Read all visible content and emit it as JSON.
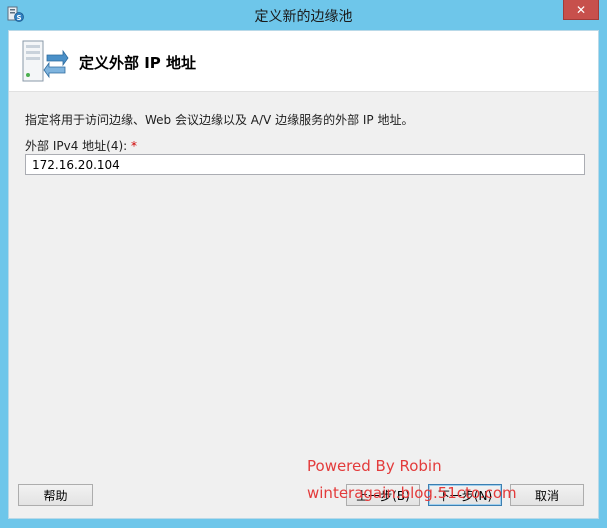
{
  "window": {
    "title": "定义新的边缘池",
    "close_glyph": "✕"
  },
  "header": {
    "title": "定义外部 IP 地址"
  },
  "main": {
    "instruction": "指定将用于访问边缘、Web 会议边缘以及 A/V 边缘服务的外部 IP 地址。",
    "ipv4_label": "外部 IPv4 地址(4):",
    "required_marker": "*",
    "ipv4_value": "172.16.20.104"
  },
  "buttons": {
    "help": "帮助",
    "back": "上一步(B)",
    "next": "下一步(N)",
    "cancel": "取消"
  },
  "watermark": {
    "line1": "Powered By Robin",
    "line2": "winteragain.blog.51cto.com"
  },
  "colors": {
    "frame": "#6ec6ea",
    "close_button": "#c7504c",
    "required": "#d00000",
    "watermark": "#e33b3b"
  }
}
